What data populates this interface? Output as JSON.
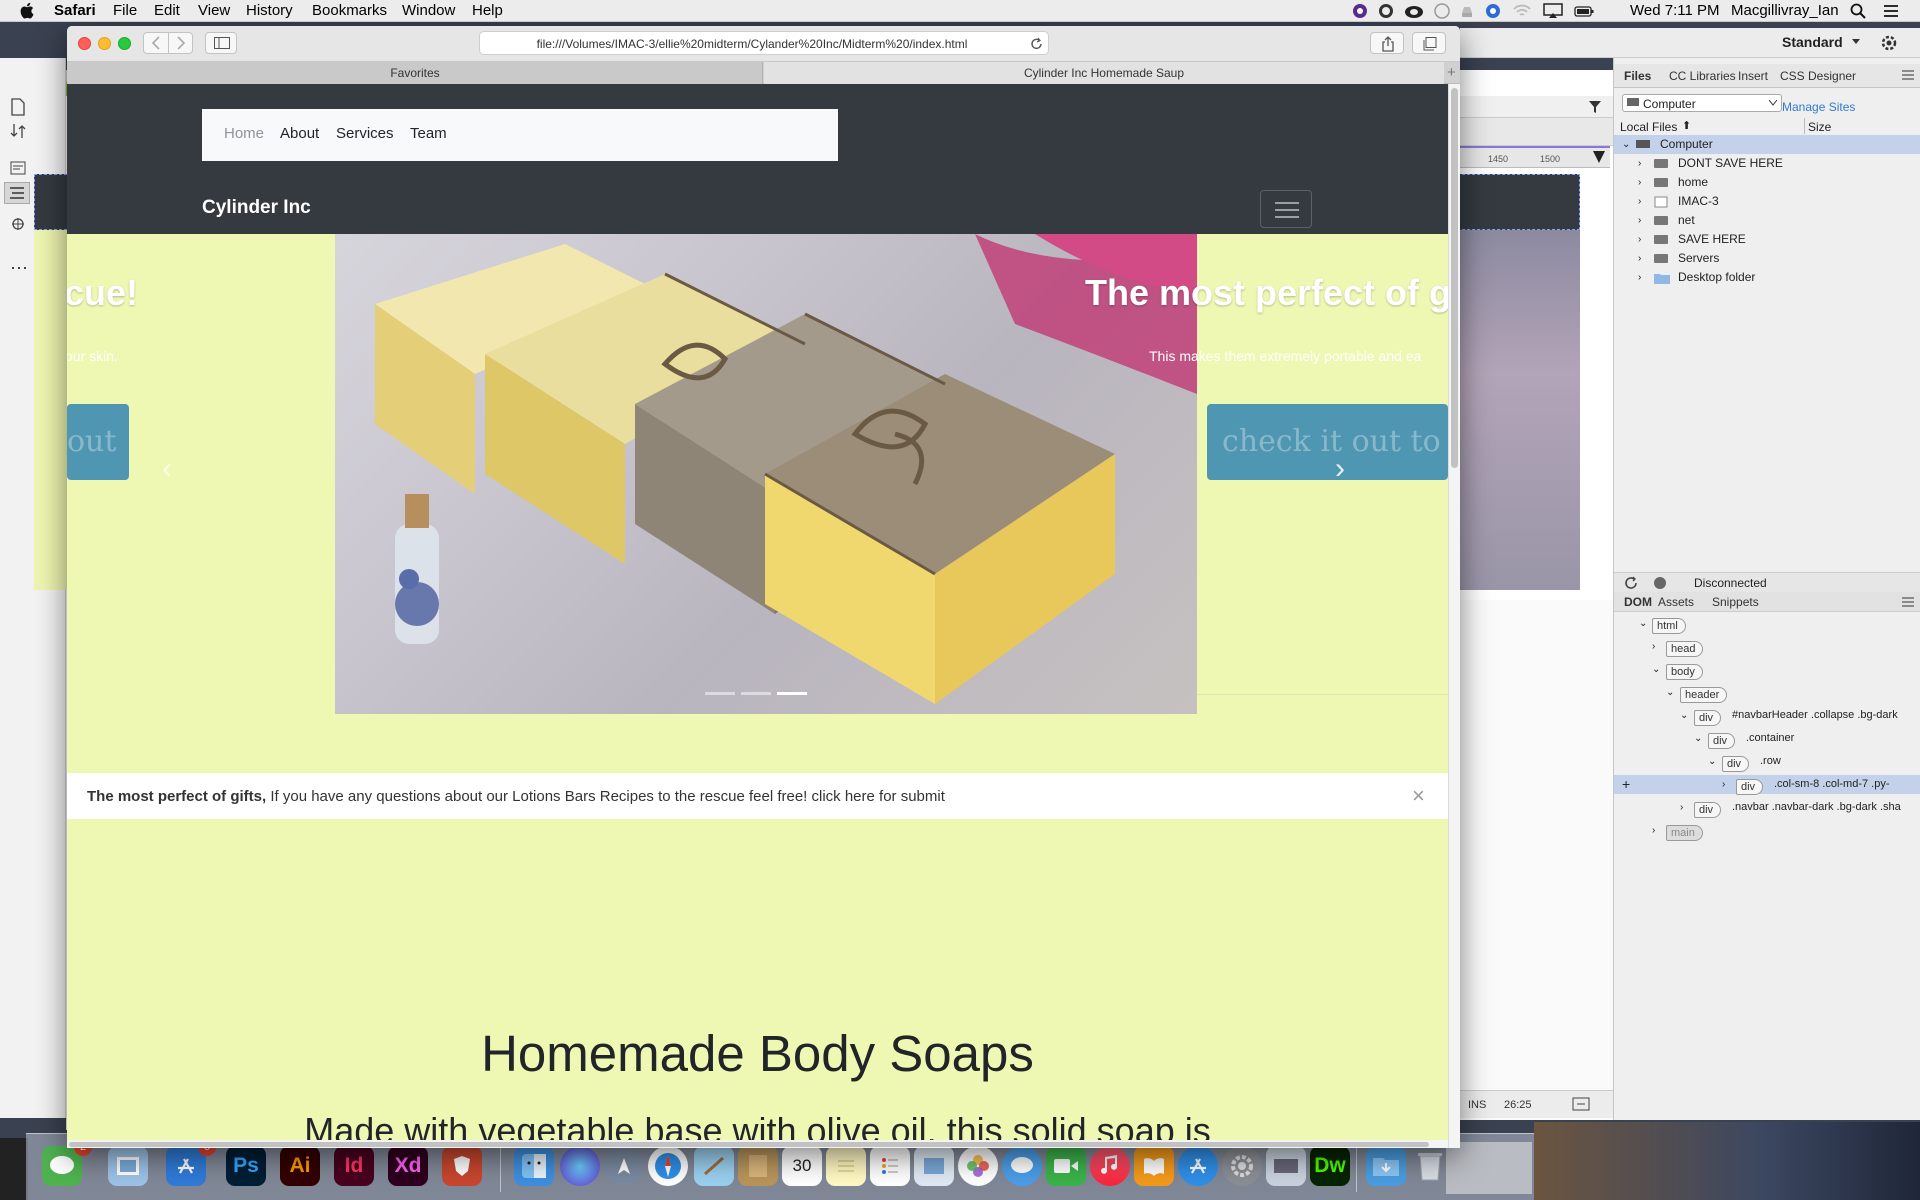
{
  "menubar": {
    "app": "Safari",
    "menus": [
      "File",
      "Edit",
      "View",
      "History",
      "Bookmarks",
      "Window",
      "Help"
    ],
    "clock": "Wed 7:11 PM",
    "user": "Macgillivray_Ian"
  },
  "safari": {
    "url": "file:///Volumes/IMAC-3/ellie%20midterm/Cylander%20Inc/Midterm%20/index.html",
    "tabs": [
      "Favorites",
      "Cylinder Inc Homemade Saup"
    ]
  },
  "page": {
    "nav_links": [
      "Home",
      "About",
      "Services",
      "Team"
    ],
    "brand": "Cylinder Inc",
    "carousel": {
      "left_heading": "cue!",
      "left_text": "our skin.",
      "left_button": "out",
      "right_heading": "The most perfect of g",
      "right_text": "This makes them extremely portable and ea",
      "right_button": "check it out to",
      "prev_glyph": "‹",
      "next_glyph": "›",
      "indicators": 3,
      "active_indicator": 3
    },
    "alert": {
      "strong": "The most perfect of gifts,",
      "text": " If you have any questions about our Lotions Bars Recipes to the rescue feel free! click here for submit",
      "close": "×"
    },
    "main_heading": "Homemade Body Soaps",
    "lead_text": "Made with vegetable base with olive oil, this solid soap is"
  },
  "dreamweaver": {
    "workspace": "Standard",
    "panel_tabs": [
      "Files",
      "CC Libraries",
      "Insert",
      "CSS Designer"
    ],
    "site_select": "Computer",
    "manage_sites": "Manage Sites",
    "col_local_files": "Local Files",
    "col_size": "Size",
    "tree_root": "Computer",
    "tree_items": [
      "DONT SAVE HERE",
      "home",
      "IMAC-3",
      "net",
      "SAVE HERE",
      "Servers",
      "Desktop folder"
    ],
    "status": "Disconnected",
    "dom_tabs": [
      "DOM",
      "Assets",
      "Snippets"
    ],
    "dom_tags": [
      "html",
      "head",
      "body",
      "header",
      "div",
      "div",
      "div",
      "div",
      "div",
      "main"
    ],
    "dom_labels": [
      "",
      "",
      "",
      "",
      "#navbarHeader .collapse .bg-dark",
      ".container",
      ".row",
      ".col-sm-8 .col-md-7 .py-",
      ".navbar .navbar-dark .bg-dark .sha",
      ""
    ],
    "ruler_marks": [
      "1450",
      "1500"
    ],
    "ins": "INS",
    "cursor_pos": "26:25"
  },
  "dock": {
    "apps": [
      "Ps",
      "Ai",
      "Id",
      "Xd",
      "Dw"
    ],
    "badges": [
      "2",
      "5"
    ],
    "calendar_day": "30"
  },
  "colors": {
    "navbar": "#343a40",
    "page_bg": "#eff8b2",
    "button": "#4f96b3",
    "dw_selection": "#c3d2ea"
  }
}
